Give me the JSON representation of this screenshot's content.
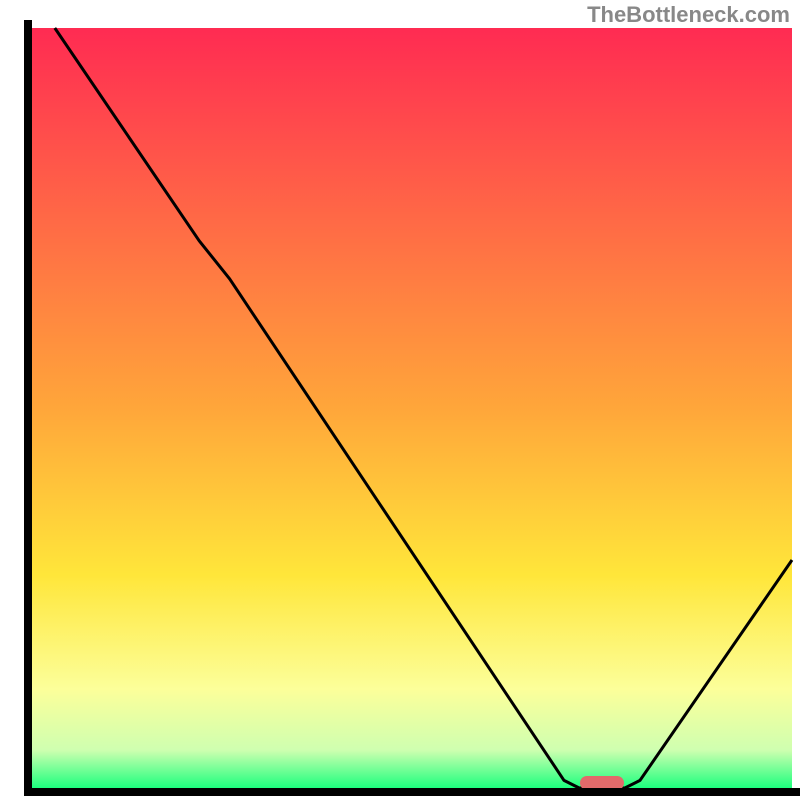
{
  "watermark": "TheBottleneck.com",
  "chart_data": {
    "type": "line",
    "title": "",
    "xlabel": "",
    "ylabel": "",
    "xlim": [
      0,
      100
    ],
    "ylim": [
      0,
      100
    ],
    "marker": {
      "x": 75,
      "y": 0,
      "color": "#e26a6a"
    },
    "background_gradient": {
      "stops": [
        {
          "offset": 0.0,
          "color": "#ff2b52"
        },
        {
          "offset": 0.5,
          "color": "#ffa63a"
        },
        {
          "offset": 0.72,
          "color": "#ffe63a"
        },
        {
          "offset": 0.87,
          "color": "#fcff9a"
        },
        {
          "offset": 0.95,
          "color": "#cfffb0"
        },
        {
          "offset": 1.0,
          "color": "#1dff7e"
        }
      ]
    },
    "series": [
      {
        "name": "curve",
        "color": "#000000",
        "points": [
          {
            "x": 3,
            "y": 100
          },
          {
            "x": 22,
            "y": 72
          },
          {
            "x": 26,
            "y": 67
          },
          {
            "x": 70,
            "y": 1
          },
          {
            "x": 72,
            "y": 0
          },
          {
            "x": 78,
            "y": 0
          },
          {
            "x": 80,
            "y": 1
          },
          {
            "x": 100,
            "y": 30
          }
        ]
      }
    ],
    "axes_color": "#000000"
  }
}
